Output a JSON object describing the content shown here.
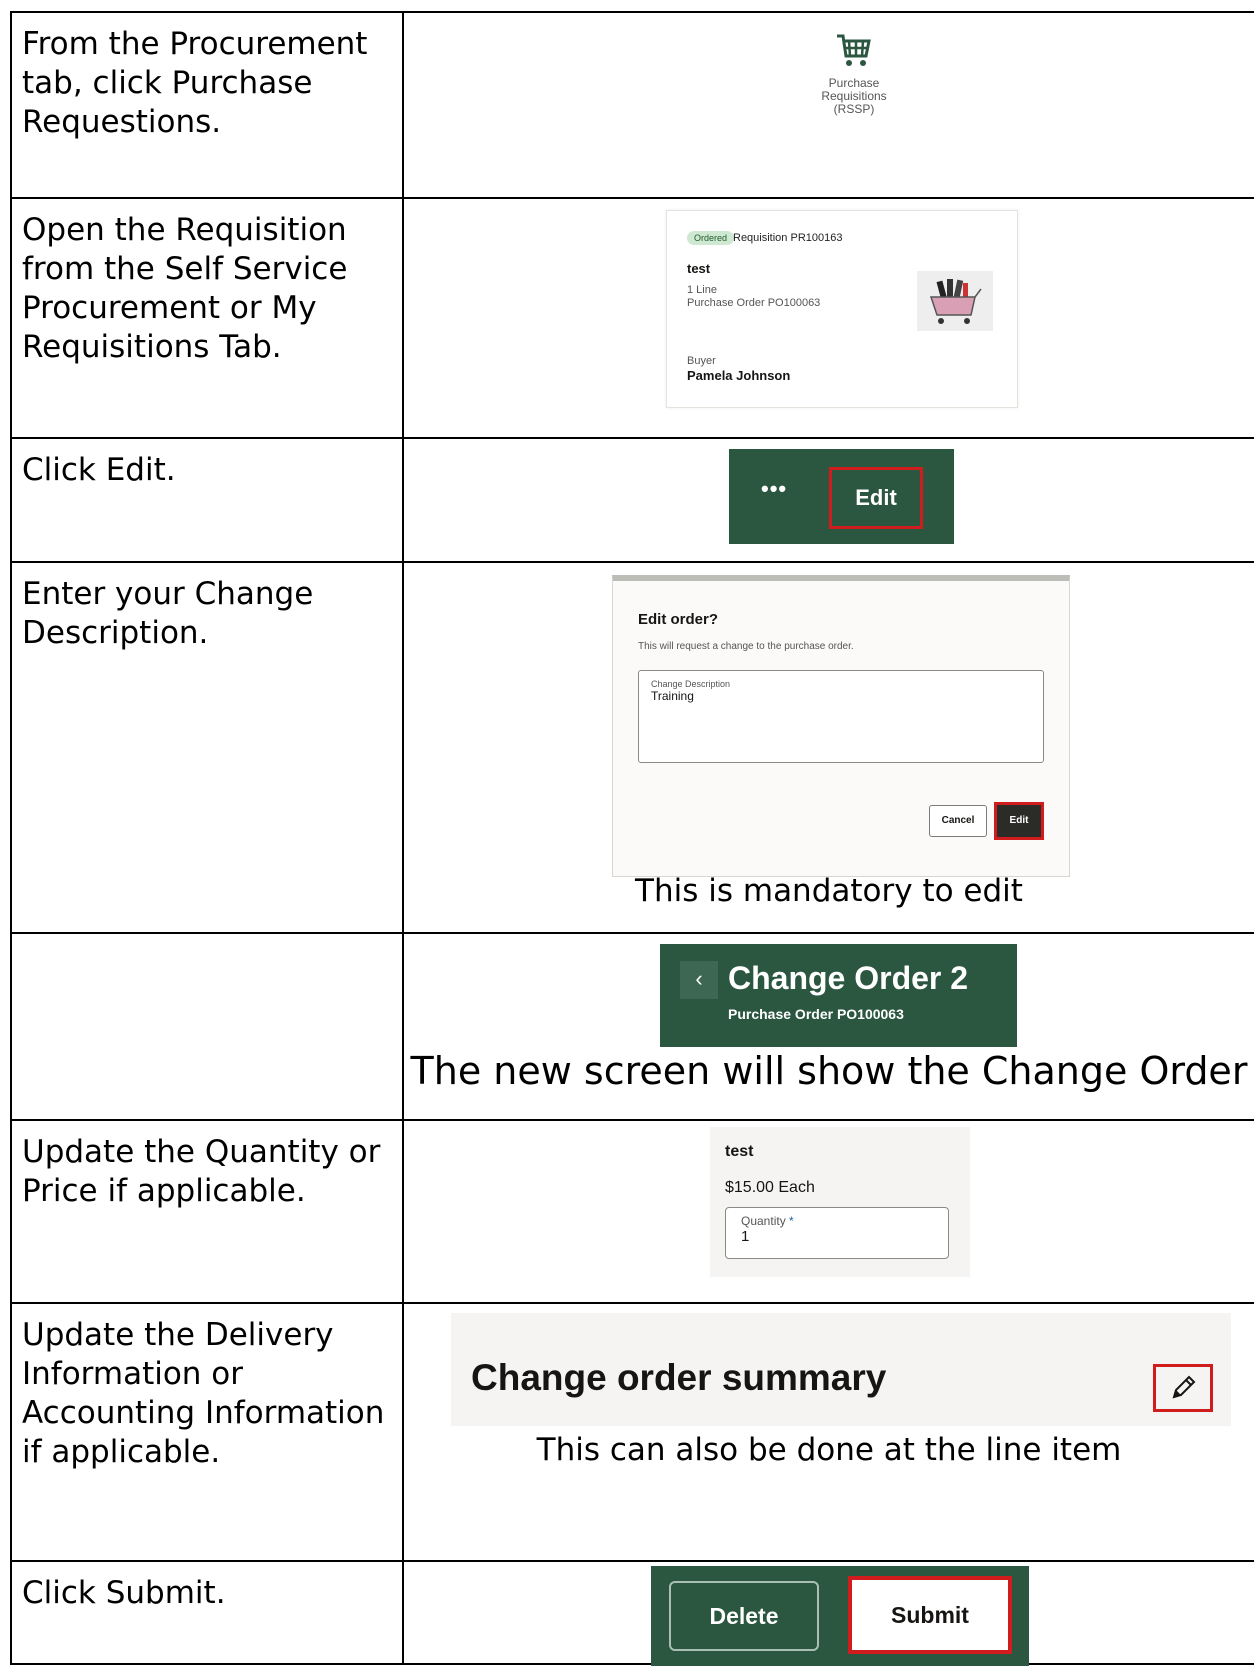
{
  "steps": [
    {
      "instruction": "From the Procurement tab, click Purchase Requestions.",
      "tile": {
        "icon": "shopping-cart-icon",
        "line1": "Purchase",
        "line2": "Requisitions",
        "line3": "(RSSP)"
      }
    },
    {
      "instruction": "Open the Requisition from the Self Service Procurement or My Requisitions Tab.",
      "card": {
        "badge": "Ordered",
        "requisition": "Requisition PR100163",
        "title": "test",
        "lines": "1 Line",
        "po": "Purchase Order PO100063",
        "buyer_label": "Buyer",
        "buyer_name": "Pamela Johnson"
      }
    },
    {
      "instruction": "Click Edit.",
      "bar": {
        "more_label": "•••",
        "edit_label": "Edit"
      }
    },
    {
      "instruction": "Enter your Change Description.",
      "dialog": {
        "title": "Edit order?",
        "subtitle": "This will request a change to the purchase order.",
        "field_label": "Change Description",
        "field_value": "Training",
        "cancel_label": "Cancel",
        "edit_label": "Edit"
      },
      "caption": "This is mandatory to edit"
    },
    {
      "instruction": "",
      "header": {
        "back": "‹",
        "title": "Change Order 2",
        "subtitle": "Purchase Order PO100063"
      },
      "caption": "The new screen will show the Change Order"
    },
    {
      "instruction": "Update the Quantity or Price if applicable.",
      "line": {
        "title": "test",
        "price": "$15.00 Each",
        "field_label": "Quantity",
        "required_mark": "*",
        "field_value": "1"
      }
    },
    {
      "instruction": "Update the Delivery Information or Accounting Information if applicable.",
      "summary": {
        "title": "Change order summary",
        "icon": "pencil-icon"
      },
      "caption": "This can also be done at the line item"
    },
    {
      "instruction": "Click Submit.",
      "actions": {
        "delete_label": "Delete",
        "submit_label": "Submit"
      }
    }
  ],
  "colors": {
    "brand_green": "#2b5740",
    "highlight_red": "#d01c1c"
  }
}
